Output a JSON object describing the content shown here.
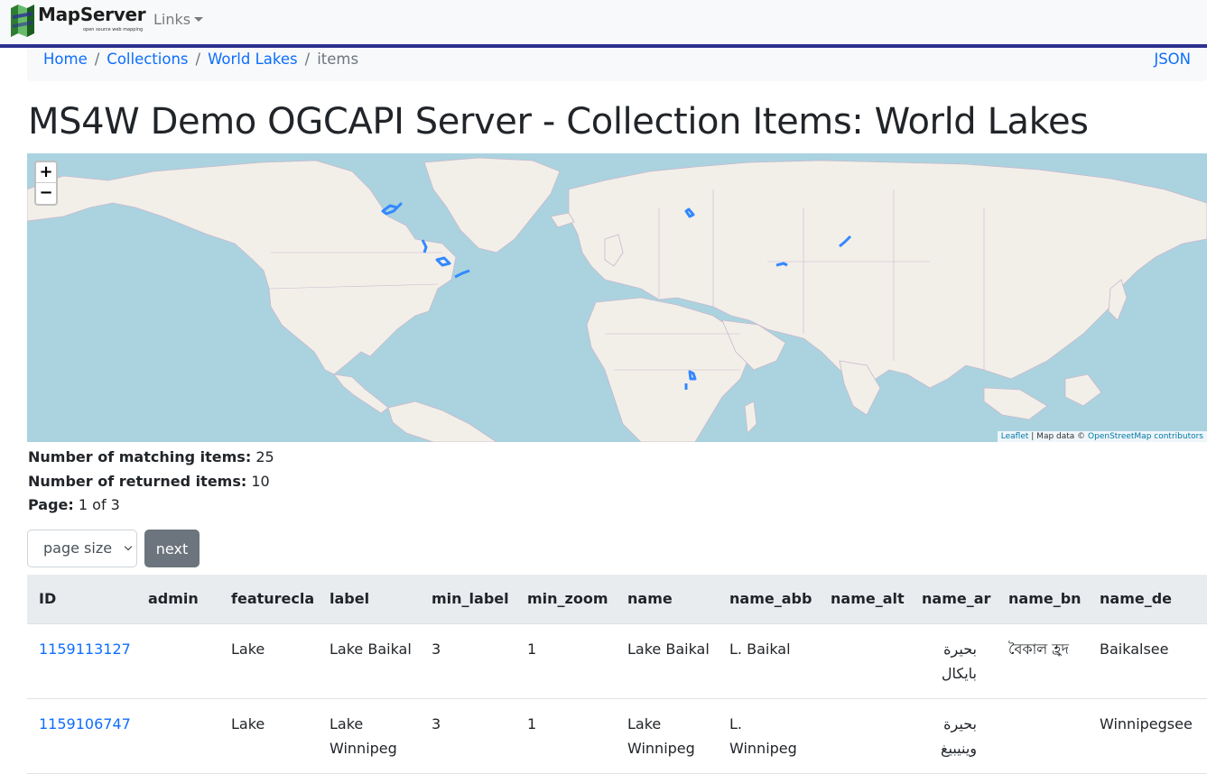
{
  "navbar": {
    "brand_name": "MapServer",
    "brand_tagline": "open source web mapping",
    "links_label": "Links"
  },
  "breadcrumb": {
    "items": [
      "Home",
      "Collections",
      "World Lakes"
    ],
    "current": "items",
    "json_label": "JSON"
  },
  "page_title": "MS4W Demo OGCAPI Server - Collection Items: World Lakes",
  "map": {
    "zoom_in": "+",
    "zoom_out": "−",
    "attribution_leaflet": "Leaflet",
    "attribution_text": " | Map data © ",
    "attribution_osm": "OpenStreetMap contributors",
    "colors": {
      "water": "#aad3df",
      "land": "#f2efe9",
      "borders": "#c9b8cc",
      "features": "#3388ff"
    }
  },
  "summary": {
    "matching_label": "Number of matching items:",
    "matching_value": "25",
    "returned_label": "Number of returned items:",
    "returned_value": "10",
    "page_label": "Page:",
    "page_value": "1 of 3"
  },
  "controls": {
    "page_size_label": "page size",
    "next_label": "next"
  },
  "table": {
    "headers": [
      "ID",
      "admin",
      "featurecla",
      "label",
      "min_label",
      "min_zoom",
      "name",
      "name_abb",
      "name_alt",
      "name_ar",
      "name_bn",
      "name_de"
    ],
    "rows": [
      [
        "1159113127",
        "",
        "Lake",
        "Lake Baikal",
        "3",
        "1",
        "Lake Baikal",
        "L. Baikal",
        "",
        "بحيرة بايكال",
        "বৈকাল হ্রদ",
        "Baikalsee"
      ],
      [
        "1159106747",
        "",
        "Lake",
        "Lake Winnipeg",
        "3",
        "1",
        "Lake Winnipeg",
        "L. Winnipeg",
        "",
        "بحيرة وينيبيغ",
        "",
        "Winnipegsee"
      ]
    ]
  }
}
